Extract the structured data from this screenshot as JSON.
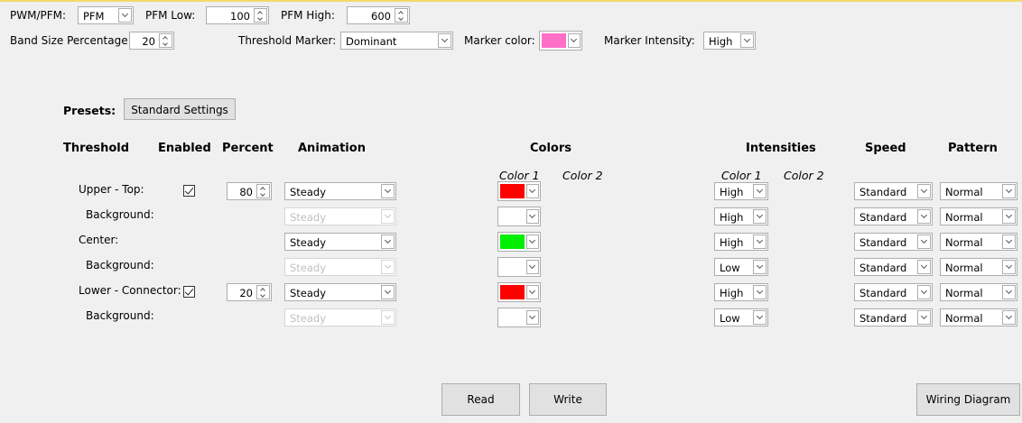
{
  "top": {
    "pwm_label": "PWM/PFM:",
    "pwm_value": "PFM",
    "pfm_low_label": "PFM Low:",
    "pfm_low_value": "100",
    "pfm_high_label": "PFM High:",
    "pfm_high_value": "600",
    "band_label": "Band Size Percentage:",
    "band_value": "20",
    "marker_label": "Threshold Marker:",
    "marker_value": "Dominant",
    "marker_color_label": "Marker color:",
    "marker_color": "#ff6ec7",
    "marker_intensity_label": "Marker Intensity:",
    "marker_intensity_value": "High"
  },
  "presets": {
    "label": "Presets:",
    "button": "Standard Settings"
  },
  "headers": {
    "threshold": "Threshold",
    "enabled": "Enabled",
    "percent": "Percent",
    "animation": "Animation",
    "colors": "Colors",
    "intensities": "Intensities",
    "speed": "Speed",
    "pattern": "Pattern",
    "color1": "Color 1",
    "color2": "Color 2",
    "int_color1": "Color 1",
    "int_color2": "Color 2"
  },
  "rows": [
    {
      "label": "Upper - Top:",
      "enabled": true,
      "percent": "80",
      "animation": "Steady",
      "animation_disabled": false,
      "color": "#ff0000",
      "intensity": "High",
      "speed": "Standard",
      "pattern": "Normal"
    },
    {
      "label": "Background:",
      "enabled": null,
      "percent": null,
      "animation": "Steady",
      "animation_disabled": true,
      "color": "#ffffff",
      "intensity": "High",
      "speed": "Standard",
      "pattern": "Normal"
    },
    {
      "label": "Center:",
      "enabled": null,
      "percent": null,
      "animation": "Steady",
      "animation_disabled": false,
      "color": "#00ee00",
      "intensity": "High",
      "speed": "Standard",
      "pattern": "Normal"
    },
    {
      "label": "Background:",
      "enabled": null,
      "percent": null,
      "animation": "Steady",
      "animation_disabled": true,
      "color": "#ffffff",
      "intensity": "Low",
      "speed": "Standard",
      "pattern": "Normal"
    },
    {
      "label": "Lower - Connector:",
      "enabled": true,
      "percent": "20",
      "animation": "Steady",
      "animation_disabled": false,
      "color": "#ff0000",
      "intensity": "High",
      "speed": "Standard",
      "pattern": "Normal"
    },
    {
      "label": "Background:",
      "enabled": null,
      "percent": null,
      "animation": "Steady",
      "animation_disabled": true,
      "color": "#ffffff",
      "intensity": "Low",
      "speed": "Standard",
      "pattern": "Normal"
    }
  ],
  "buttons": {
    "read": "Read",
    "write": "Write",
    "wiring": "Wiring Diagram"
  }
}
